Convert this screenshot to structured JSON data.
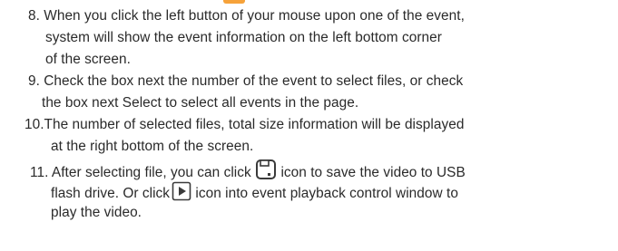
{
  "steps": [
    {
      "number": "8.",
      "lines": [
        "When you click the left button of your mouse upon one of the event,",
        "system will show the event information on the left bottom corner",
        "of the screen."
      ]
    },
    {
      "number": "9.",
      "lines": [
        "Check the box next the number of the event to select files, or check",
        "the box next Select to select all events in the page."
      ]
    },
    {
      "number": "10.",
      "lines": [
        "The number of selected files, total size information will be displayed",
        "at the right bottom of the screen."
      ]
    },
    {
      "number": "11.",
      "lines": [
        "After selecting file, you can click",
        "icon to save the video to USB",
        "flash drive. Or click",
        "icon into event playback control window to",
        "play the video."
      ]
    }
  ],
  "icons": {
    "save": "save-icon",
    "play": "play-icon",
    "top_fragment": "orange-icon-fragment",
    "top_fragment_color": "#f6a23a"
  }
}
